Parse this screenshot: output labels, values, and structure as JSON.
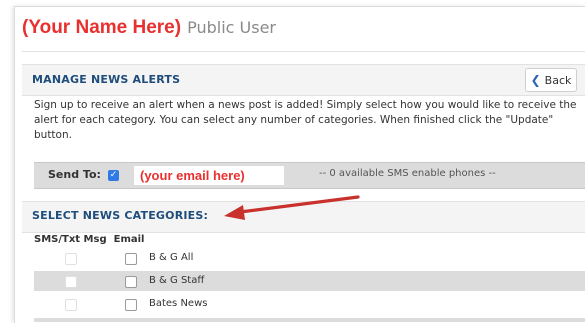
{
  "header": {
    "name_annotation": "(Your Name Here)",
    "user_type": "Public User"
  },
  "manage": {
    "title": "MANAGE NEWS ALERTS",
    "back_label": "Back",
    "back_icon": "chevron-left-icon",
    "intro": "Sign up to receive an alert when a news post is added! Simply select how you would like to receive the alert for each category. You can select any number of categories. When finished click the \"Update\" button."
  },
  "send_to": {
    "label": "Send To:",
    "email_checked": true,
    "email_annotation": "(your email here)",
    "sms_info": "-- 0 available SMS enable phones --"
  },
  "categories": {
    "title": "SELECT NEWS CATEGORIES:",
    "col_sms": "SMS/Txt Msg",
    "col_email": "Email",
    "items": [
      {
        "label": "B & G All",
        "sms": false,
        "email": false
      },
      {
        "label": "B & G Staff",
        "sms": false,
        "email": false
      },
      {
        "label": "Bates News",
        "sms": false,
        "email": false
      }
    ]
  },
  "colors": {
    "annotation_red": "#e8312f",
    "heading_blue": "#1e4d7b",
    "checkbox_blue": "#2f7ae5",
    "arrow_red": "#c8312c",
    "row_gray": "#dcdcdc"
  }
}
